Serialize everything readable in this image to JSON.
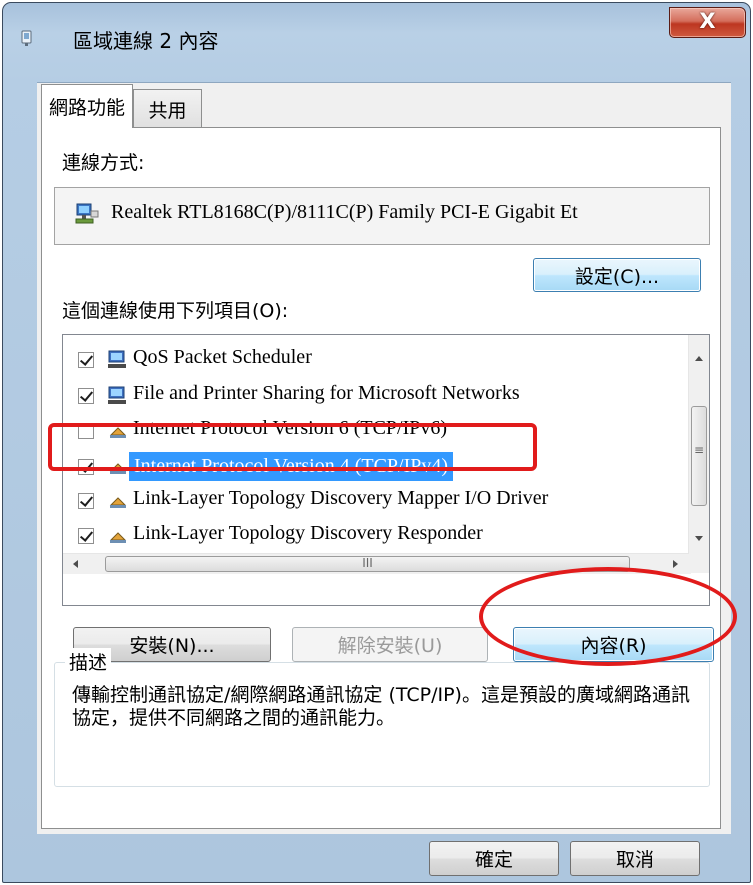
{
  "window": {
    "title": "區域連線 2 內容",
    "close_symbol": "X"
  },
  "tabs": [
    {
      "label": "網路功能",
      "active": true
    },
    {
      "label": "共用",
      "active": false
    }
  ],
  "connect_using": {
    "label": "連線方式:",
    "adapter": "Realtek RTL8168C(P)/8111C(P) Family PCI-E Gigabit Et",
    "configure_button": "設定(C)..."
  },
  "items_list": {
    "label": "這個連線使用下列項目(O):",
    "items": [
      {
        "label": "QoS Packet Scheduler",
        "checked": true,
        "icon": "network-service-icon"
      },
      {
        "label": "File and Printer Sharing for Microsoft Networks",
        "checked": true,
        "icon": "network-service-icon"
      },
      {
        "label": "Internet Protocol Version 6 (TCP/IPv6)",
        "checked": false,
        "icon": "protocol-icon"
      },
      {
        "label": "Internet Protocol Version 4 (TCP/IPv4)",
        "checked": true,
        "icon": "protocol-icon",
        "selected": true
      },
      {
        "label": "Link-Layer Topology Discovery Mapper I/O Driver",
        "checked": true,
        "icon": "protocol-icon"
      },
      {
        "label": "Link-Layer Topology Discovery Responder",
        "checked": true,
        "icon": "protocol-icon"
      }
    ],
    "hscroll_grip": "III",
    "vscroll_grip": "≡"
  },
  "buttons": {
    "install": "安裝(N)...",
    "uninstall": "解除安裝(U)",
    "properties": "內容(R)"
  },
  "description": {
    "title": "描述",
    "text": "傳輸控制通訊協定/網際網路通訊協定 (TCP/IP)。這是預設的廣域網路通訊協定，提供不同網路之間的通訊能力。"
  },
  "footer": {
    "ok": "確定",
    "cancel": "取消"
  },
  "colors": {
    "selection": "#3399ff",
    "annotation": "#e11b1b",
    "close_button": "#c75050"
  }
}
